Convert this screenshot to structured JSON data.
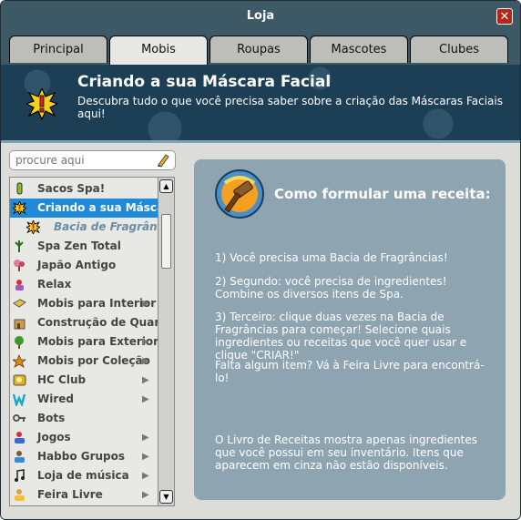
{
  "window": {
    "title": "Loja",
    "close_glyph": "✕"
  },
  "tabs": [
    {
      "label": "Principal"
    },
    {
      "label": "Mobis"
    },
    {
      "label": "Roupas"
    },
    {
      "label": "Mascotes"
    },
    {
      "label": "Clubes"
    }
  ],
  "active_tab": "Mobis",
  "banner": {
    "title": "Criando a sua Máscara Facial",
    "subtitle": "Descubra tudo o que você precisa saber sobre a criação das Máscaras Faciais aqui!",
    "icon": "exclamation-burst-icon"
  },
  "search": {
    "placeholder": "procure aqui",
    "value": ""
  },
  "sidebar": {
    "items": [
      {
        "label": "Sacos Spa!",
        "icon": "spa-bag-icon",
        "has_arrow": false
      },
      {
        "label": "Criando a sua Máscara Facial",
        "icon": "exclamation-burst-icon",
        "selected": true,
        "has_arrow": false
      },
      {
        "label": "Bacia de Fragrâncias",
        "icon": "exclamation-burst-icon",
        "sub": true,
        "has_arrow": false
      },
      {
        "label": "Spa Zen Total",
        "icon": "plant-icon",
        "has_arrow": false
      },
      {
        "label": "Japão Antigo",
        "icon": "bonsai-icon",
        "has_arrow": false
      },
      {
        "label": "Relax",
        "icon": "relax-icon",
        "has_arrow": false
      },
      {
        "label": "Mobis para Interior",
        "icon": "sofa-icon",
        "has_arrow": true
      },
      {
        "label": "Construção de Quartos",
        "icon": "building-icon",
        "has_arrow": false
      },
      {
        "label": "Mobis para Exterior",
        "icon": "tree-icon",
        "has_arrow": true
      },
      {
        "label": "Mobis por Coleção",
        "icon": "star-icon",
        "has_arrow": true
      },
      {
        "label": "HC Club",
        "icon": "hc-icon",
        "has_arrow": true
      },
      {
        "label": "Wired",
        "icon": "wired-icon",
        "has_arrow": true
      },
      {
        "label": "Bots",
        "icon": "key-icon",
        "has_arrow": false
      },
      {
        "label": "Jogos",
        "icon": "game-icon",
        "has_arrow": true
      },
      {
        "label": "Habbo Grupos",
        "icon": "group-icon",
        "has_arrow": true
      },
      {
        "label": "Loja de música",
        "icon": "music-note-icon",
        "has_arrow": true
      },
      {
        "label": "Feira Livre",
        "icon": "market-icon",
        "has_arrow": true
      }
    ]
  },
  "panel": {
    "icon": "hammer-icon",
    "title": "Como formular uma receita:",
    "steps": [
      "1) Você precisa uma Bacia de Fragrâncias!",
      "2) Segundo: você precisa de ingredientes! Combine os diversos itens de Spa.",
      "3) Terceiro: clique duas vezes na Bacia de Fragrâncias para começar! Selecione quais ingredientes ou receitas que você quer usar e clique \"CRIAR!\""
    ],
    "hint": "Falta algum item? Vá à Feira Livre para encontrá-lo!",
    "footer": "O Livro de Receitas mostra apenas ingredientes que você possui em seu inventário. Itens que aparecem em cinza não estão disponíveis."
  }
}
